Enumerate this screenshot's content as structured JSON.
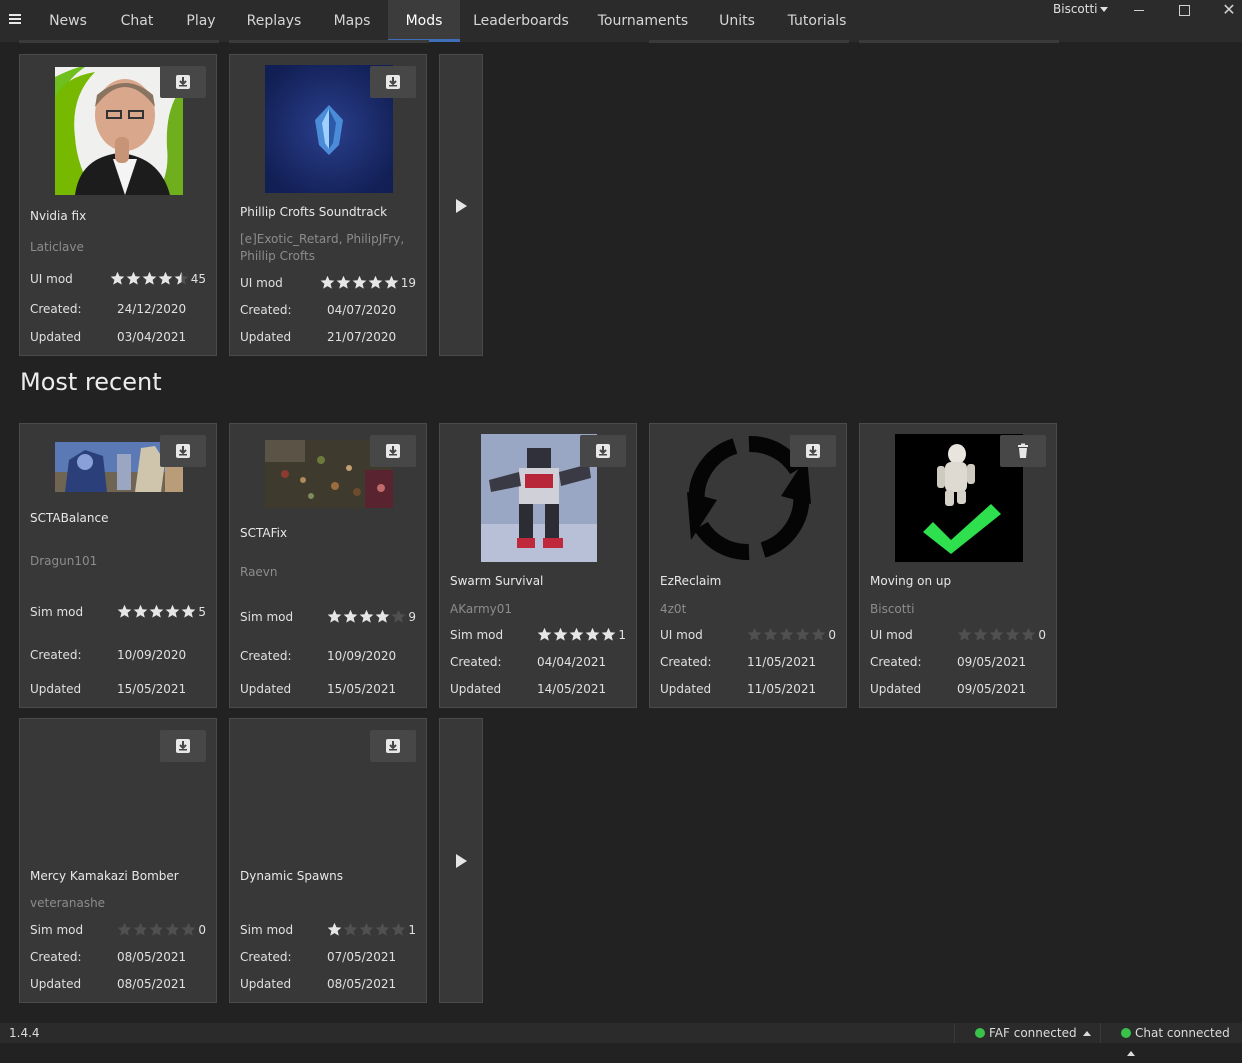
{
  "nav": {
    "tabs": [
      "News",
      "Chat",
      "Play",
      "Replays",
      "Maps",
      "Mods",
      "Leaderboards",
      "Tournaments",
      "Units",
      "Tutorials"
    ],
    "active_tab": "Mods",
    "user": "Biscotti"
  },
  "section_most_recent": "Most recent",
  "labels": {
    "created": "Created:",
    "updated": "Updated"
  },
  "top_cards": [
    {
      "name": "Nvidia fix",
      "author": "Laticlave",
      "type": "UI mod",
      "rating": 4.5,
      "count": "45",
      "created": "24/12/2020",
      "updated": "03/04/2021",
      "action": "download",
      "image": "portrait-photo"
    },
    {
      "name": "Phillip Crofts Soundtrack",
      "author": "[e]Exotic_Retard, PhilipJFry, Phillip Crofts",
      "type": "UI mod",
      "rating": 5,
      "count": "19",
      "created": "04/07/2020",
      "updated": "21/07/2020",
      "action": "download",
      "image": "blue-emblem"
    }
  ],
  "recent_cards": [
    {
      "name": "SCTABalance",
      "author": "Dragun101",
      "type": "Sim mod",
      "rating": 5,
      "count": "5",
      "created": "10/09/2020",
      "updated": "15/05/2021",
      "action": "download",
      "image": "robots-screenshot"
    },
    {
      "name": "SCTAFix",
      "author": "Raevn",
      "type": "Sim mod",
      "rating": 4,
      "count": "9",
      "created": "10/09/2020",
      "updated": "15/05/2021",
      "action": "download",
      "image": "battle-screenshot"
    },
    {
      "name": "Swarm Survival",
      "author": "AKarmy01",
      "type": "Sim mod",
      "rating": 5,
      "count": "1",
      "created": "04/04/2021",
      "updated": "14/05/2021",
      "action": "download",
      "image": "robot-toy"
    },
    {
      "name": "EzReclaim",
      "author": "4z0t",
      "type": "UI mod",
      "rating": 0,
      "count": "0",
      "created": "11/05/2021",
      "updated": "11/05/2021",
      "action": "download",
      "image": "refresh-icon"
    },
    {
      "name": "Moving on up",
      "author": "Biscotti",
      "type": "UI mod",
      "rating": 0,
      "count": "0",
      "created": "09/05/2021",
      "updated": "09/05/2021",
      "action": "delete",
      "image": "astronaut-check"
    }
  ],
  "bottom_cards": [
    {
      "name": "Mercy Kamakazi Bomber",
      "author": "veteranashe",
      "type": "Sim mod",
      "rating": 0,
      "count": "0",
      "created": "08/05/2021",
      "updated": "08/05/2021",
      "action": "download"
    },
    {
      "name": "Dynamic Spawns",
      "author": "",
      "type": "Sim mod",
      "rating": 1,
      "count": "1",
      "created": "07/05/2021",
      "updated": "08/05/2021",
      "action": "download"
    }
  ],
  "status": {
    "version": "1.4.4",
    "faf": "FAF connected",
    "chat": "Chat connected",
    "status_color": "#3ac14a"
  }
}
